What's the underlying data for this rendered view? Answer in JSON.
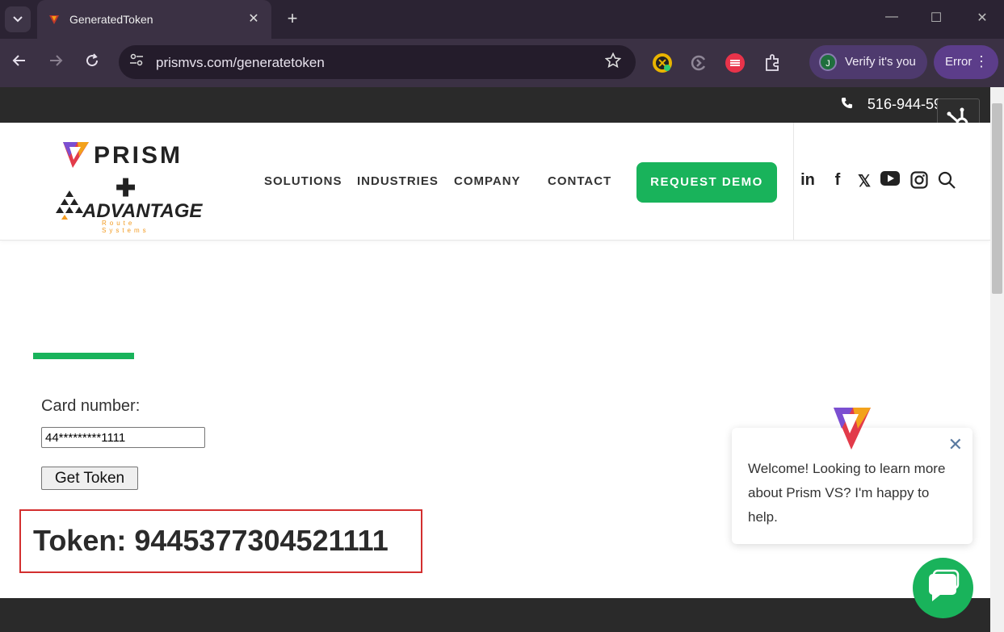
{
  "browser": {
    "tab_title": "GeneratedToken",
    "tab_close": "✕",
    "new_tab": "+",
    "url": "prismvs.com/generatetoken",
    "profile_initial": "J",
    "verify_label": "Verify it's you",
    "error_label": "Error",
    "minimize": "—",
    "maximize": "☐",
    "close": "✕"
  },
  "topbar": {
    "phone": "516-944-59"
  },
  "logo": {
    "prism": "PRISM",
    "plus": "✚",
    "advantage": "ADVANTAGE",
    "advantage_sub": "Route Systems"
  },
  "nav": {
    "solutions": "SOLUTIONS",
    "industries": "INDUSTRIES",
    "company": "COMPANY",
    "contact": "CONTACT",
    "demo": "REQUEST DEMO"
  },
  "social": {
    "linkedin": "in",
    "facebook": "f",
    "x": "𝕏"
  },
  "form": {
    "card_label": "Card number:",
    "card_value": "44*********1111",
    "get_token": "Get Token",
    "token_text": "Token: 9445377304521111"
  },
  "chat": {
    "message": "Welcome! Looking to learn more about Prism VS? I'm happy to help.",
    "close": "✕"
  },
  "colors": {
    "accent_green": "#19b35b",
    "token_border": "#d32f2f",
    "chrome_dark": "#3b3144"
  }
}
